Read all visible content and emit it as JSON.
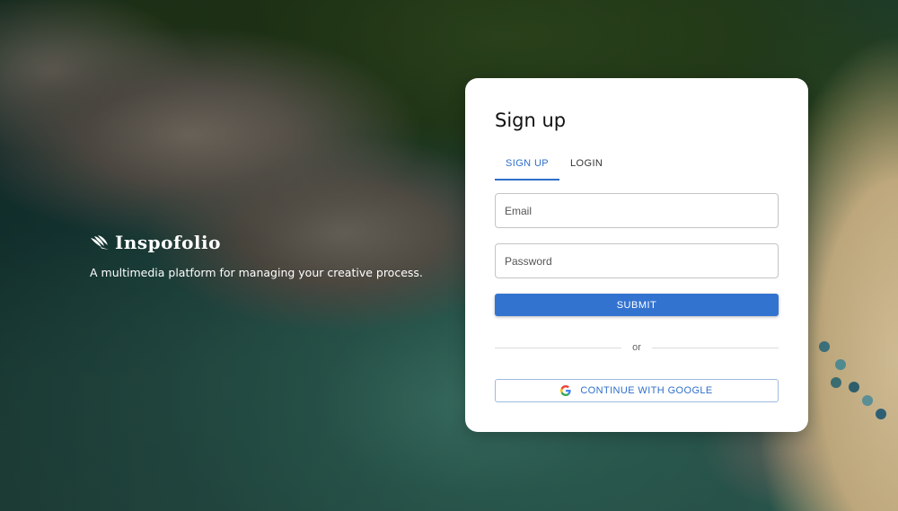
{
  "brand": {
    "name": "Inspofolio",
    "tagline": "A multimedia platform for managing your creative process."
  },
  "card": {
    "title": "Sign up",
    "tabs": [
      {
        "label": "SIGN UP",
        "active": true
      },
      {
        "label": "LOGIN",
        "active": false
      }
    ],
    "email_placeholder": "Email",
    "password_placeholder": "Password",
    "submit_label": "SUBMIT",
    "divider_text": "or",
    "google_label": "CONTINUE WITH GOOGLE"
  },
  "colors": {
    "accent": "#3373d0",
    "card_bg": "#ffffff",
    "text_dark": "#111111"
  },
  "icons": {
    "brand_logo": "wing-logo-icon",
    "google": "google-icon"
  }
}
